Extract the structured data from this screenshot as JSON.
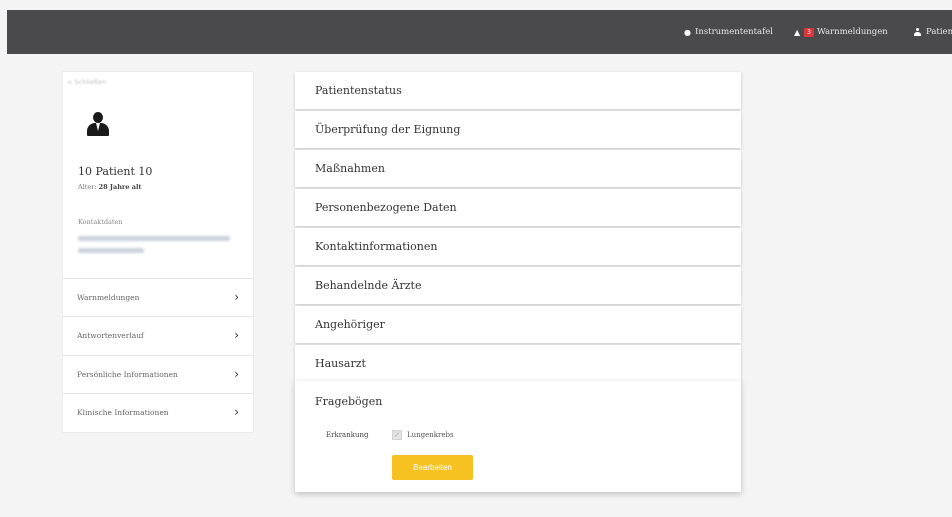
{
  "topnav": {
    "dashboard": "Instrumententafel",
    "alerts_count": "3",
    "alerts": "Warnmeldungen",
    "patients": "Patiente"
  },
  "sidebar": {
    "back": "< Schließen",
    "patient_name": "10 Patient 10",
    "age_label": "Alter:",
    "age_value": "28 Jahre alt",
    "contact_label": "Kontaktdaten",
    "items": [
      {
        "label": "Warnmeldungen"
      },
      {
        "label": "Antwortenverlauf"
      },
      {
        "label": "Persönliche Informationen"
      },
      {
        "label": "Klinische Informationen"
      }
    ]
  },
  "accordion": {
    "sections": [
      "Patientenstatus",
      "Überprüfung der Eignung",
      "Maßnahmen",
      "Personenbezogene Daten",
      "Kontaktinformationen",
      "Behandelnde Ärzte",
      "Angehöriger",
      "Hausarzt"
    ],
    "open_section": {
      "title": "Fragebögen",
      "field_label": "Erkrankung",
      "checkbox_label": "Lungenkrebs",
      "checkbox_checked": true,
      "button": "Bearbeiten"
    }
  },
  "colors": {
    "topbar": "#4a4a4c",
    "accent": "#f6c221",
    "badge": "#d9363e"
  }
}
